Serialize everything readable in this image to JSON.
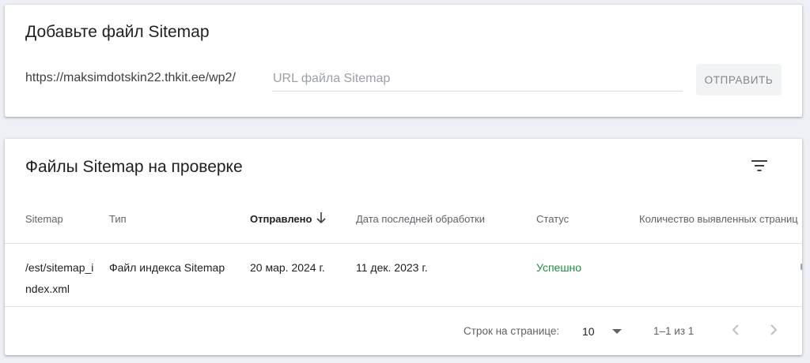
{
  "add_sitemap": {
    "title": "Добавьте файл Sitemap",
    "url_prefix": "https://maksimdotskin22.thkit.ee/wp2/",
    "input_placeholder": "URL файла Sitemap",
    "input_value": "",
    "submit_label": "ОТПРАВИТЬ"
  },
  "submitted": {
    "title": "Файлы Sitemap на проверке",
    "filter_icon": "filter-list-icon",
    "columns": [
      "Sitemap",
      "Тип",
      "Отправлено",
      "Дата последней обработки",
      "Статус",
      "Количество выявленных страниц"
    ],
    "sorted_column": "Отправлено",
    "sort_icon": "arrow-down-icon",
    "rows": [
      {
        "sitemap": "/est/sitemap_index.xml",
        "type": "Файл индекса Sitemap",
        "submitted": "20 мар. 2024 г.",
        "last_read": "11 дек. 2023 г.",
        "status": "Успешно"
      }
    ],
    "pagination": {
      "rows_per_page_label": "Строк на странице:",
      "rows_per_page_value": "10",
      "range_label": "1–1 из 1",
      "prev_icon": "chevron-left-icon",
      "next_icon": "chevron-right-icon"
    }
  },
  "colors": {
    "background": "#eef0f5",
    "card": "#ffffff",
    "status_success": "#1e8e3e",
    "button_bg": "#f1f3f4",
    "button_text": "#80868b"
  }
}
